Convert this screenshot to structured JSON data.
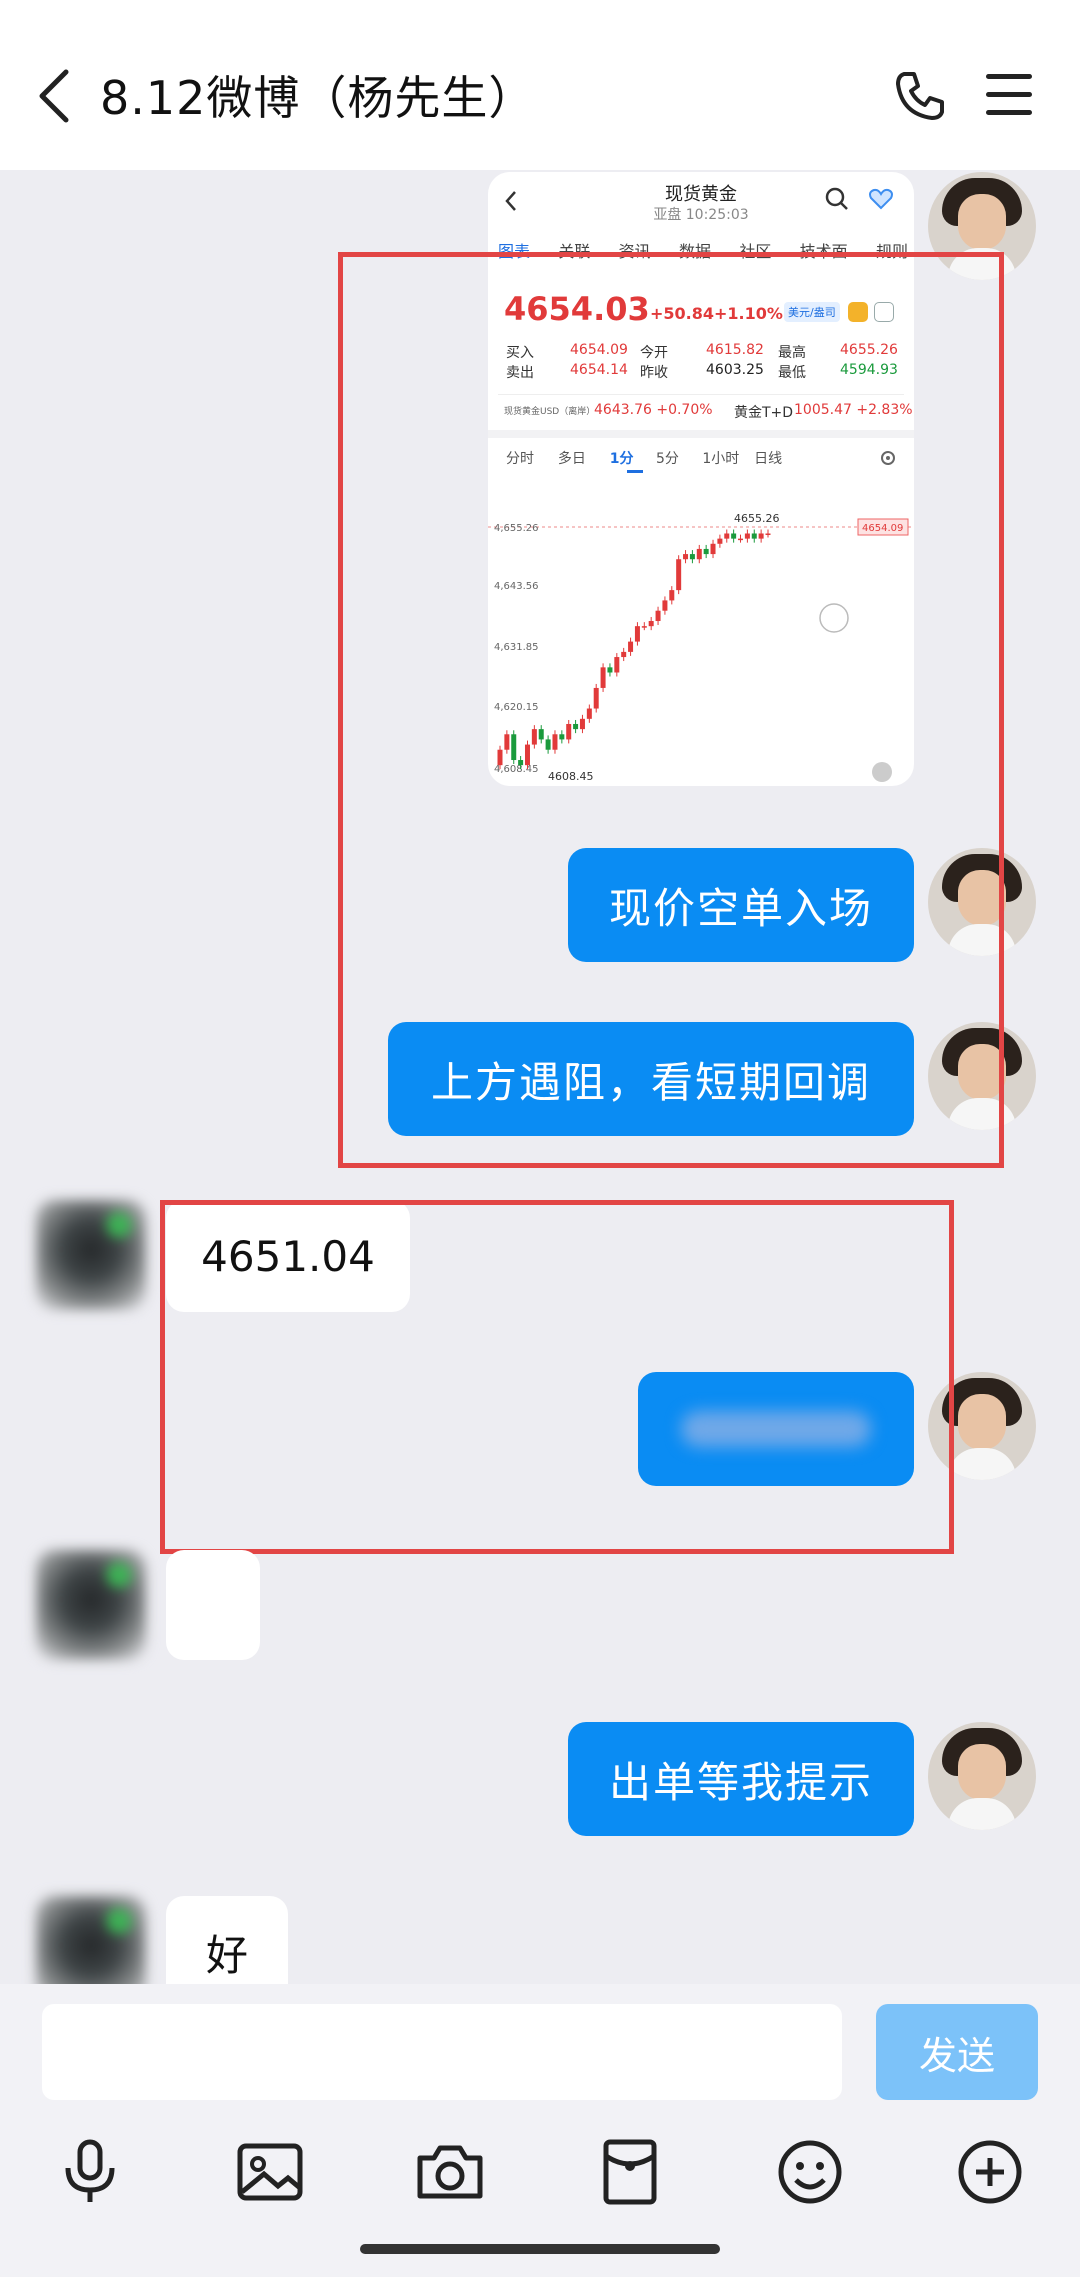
{
  "header": {
    "title": "8.12微博（杨先生）"
  },
  "embedded_screenshot": {
    "title": "现货黄金",
    "subtitle": "亚盘 10:25:03",
    "tabs": [
      "图表",
      "关联",
      "资讯",
      "数据",
      "社区",
      "技术面",
      "规则"
    ],
    "price": "4654.03",
    "change": "+50.84",
    "change_pct": "+1.10%",
    "unit_badge": "美元/盎司",
    "buy_label": "买入",
    "buy_value": "4654.09",
    "sell_label": "卖出",
    "sell_value": "4654.14",
    "open_label": "今开",
    "open_value": "4615.82",
    "prev_label": "昨收",
    "prev_value": "4603.25",
    "high_label": "最高",
    "high_value": "4655.26",
    "low_label": "最低",
    "low_value": "4594.93",
    "ref_label": "现货黄金USD（离岸）",
    "ref_value": "4643.76 +0.70%",
    "td_label": "黄金T+D",
    "td_value": "1005.47 +2.83%",
    "periods": [
      "分时",
      "多日",
      "1分",
      "5分",
      "1小时",
      "日线"
    ],
    "y_ticks": [
      "4,655.26",
      "4,643.56",
      "4,631.85",
      "4,620.15",
      "4,608.45"
    ],
    "high_marker": "4655.26",
    "low_marker": "4608.45",
    "last_marker": "4654.09"
  },
  "chart_data": {
    "type": "candlestick",
    "ylim": [
      4608.45,
      4655.26
    ],
    "closes": [
      4612,
      4615,
      4610,
      4609,
      4613,
      4616,
      4614,
      4612,
      4615,
      4614,
      4617,
      4616,
      4618,
      4620,
      4624,
      4628,
      4627,
      4630,
      4631,
      4633,
      4636,
      4636,
      4637,
      4639,
      4641,
      4643,
      4649,
      4650,
      4649,
      4651,
      4650,
      4652,
      4653,
      4654,
      4653,
      4653,
      4654,
      4653,
      4654,
      4654
    ],
    "opens": [
      4609,
      4612,
      4615,
      4610,
      4609,
      4613,
      4616,
      4614,
      4612,
      4615,
      4614,
      4617,
      4616,
      4618,
      4620,
      4624,
      4628,
      4627,
      4630,
      4631,
      4633,
      4636,
      4636,
      4637,
      4639,
      4641,
      4643,
      4649,
      4650,
      4649,
      4651,
      4650,
      4652,
      4653,
      4654,
      4653,
      4653,
      4654,
      4653,
      4654
    ]
  },
  "messages": {
    "m1": "现价空单入场",
    "m2": "上方遇阻，看短期回调",
    "m3": "4651.04",
    "m5": "出单等我提示",
    "m6": "好"
  },
  "input": {
    "send_label": "发送"
  }
}
